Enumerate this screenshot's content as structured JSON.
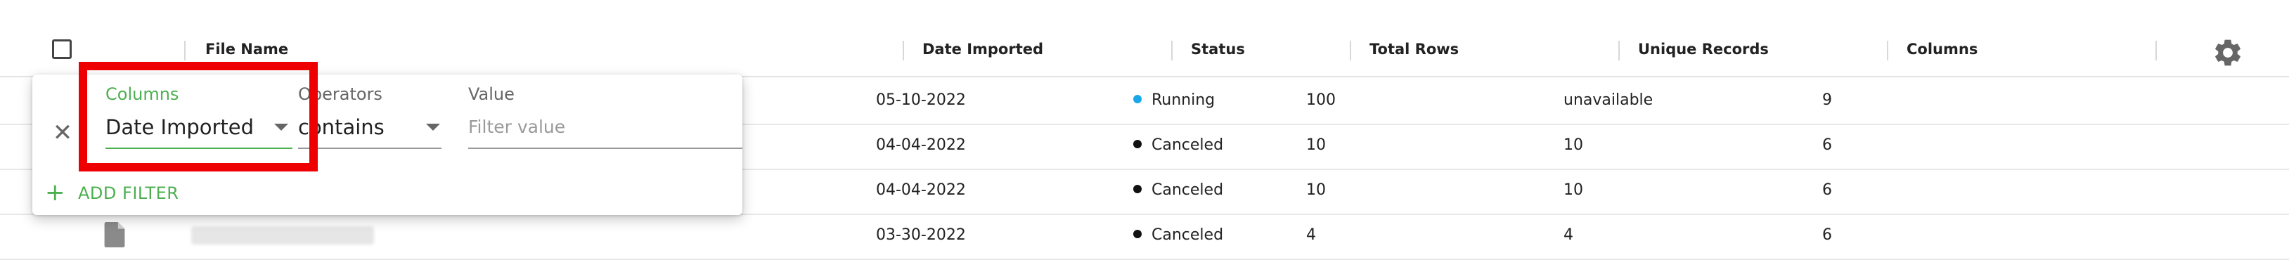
{
  "table": {
    "columns": [
      "File Name",
      "Date Imported",
      "Status",
      "Total Rows",
      "Unique Records",
      "Columns"
    ],
    "rows": [
      {
        "date": "05-10-2022",
        "status": "Running",
        "status_color": "#1aa7e8",
        "total_rows": "100",
        "unique": "unavailable",
        "columns": "9"
      },
      {
        "date": "04-04-2022",
        "status": "Canceled",
        "status_color": "#111111",
        "total_rows": "10",
        "unique": "10",
        "columns": "6"
      },
      {
        "date": "04-04-2022",
        "status": "Canceled",
        "status_color": "#111111",
        "total_rows": "10",
        "unique": "10",
        "columns": "6"
      },
      {
        "date": "03-30-2022",
        "status": "Canceled",
        "status_color": "#111111",
        "total_rows": "4",
        "unique": "4",
        "columns": "6"
      }
    ]
  },
  "filter": {
    "columns_label": "Columns",
    "columns_value": "Date Imported",
    "operators_label": "Operators",
    "operators_value": "contains",
    "value_label": "Value",
    "value_placeholder": "Filter value",
    "add_filter_label": "ADD FILTER",
    "accent_color": "#4caf50"
  },
  "icons": {
    "settings": "gear-icon",
    "close": "close-icon",
    "add": "plus-icon",
    "file": "file-icon"
  }
}
